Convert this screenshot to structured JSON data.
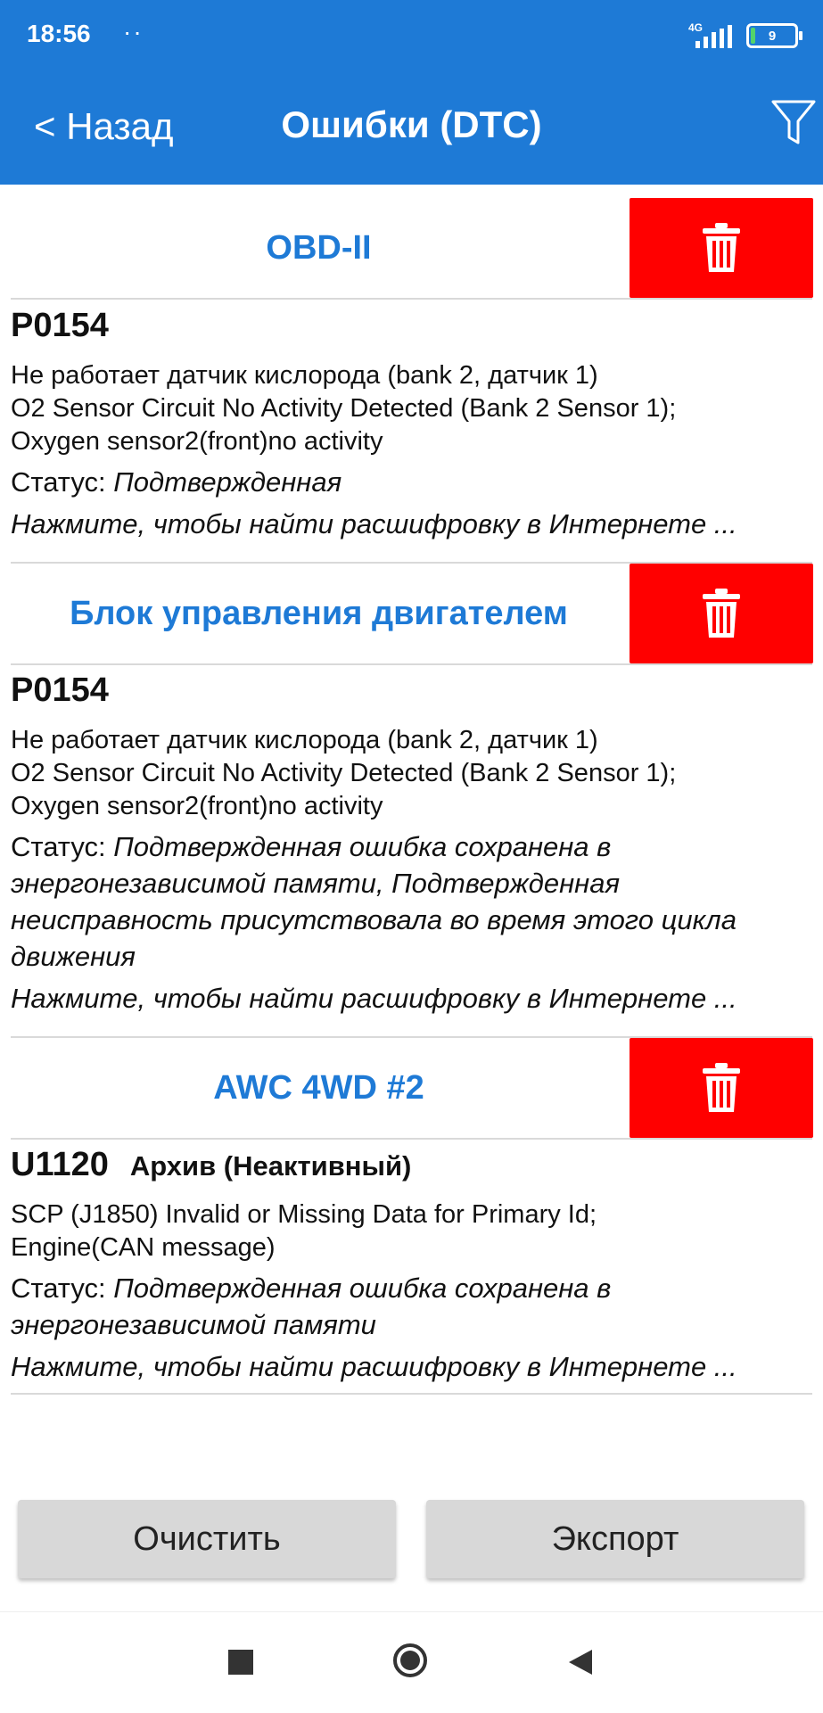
{
  "status_bar": {
    "time": "18:56",
    "dots": "··",
    "network": "4G",
    "battery": "9"
  },
  "app_bar": {
    "back_label": "< Назад",
    "title": "Ошибки (DTC)",
    "filter_icon": "filter-icon"
  },
  "sections": [
    {
      "title": "OBD-II",
      "dtc": {
        "code": "P0154",
        "description_ru": "Не работает датчик кислорода (bank 2, датчик 1)",
        "description_en": "O2 Sensor Circuit No Activity Detected (Bank 2 Sensor 1);",
        "description_en2": "Oxygen sensor2(front)no activity",
        "status_label": "Статус:",
        "status_value": "Подтвержденная",
        "link": "Нажмите, чтобы найти расшифровку в Интернете ..."
      }
    },
    {
      "title": "Блок управления двигателем",
      "dtc": {
        "code": "P0154",
        "description_ru": "Не работает датчик кислорода (bank 2, датчик 1)",
        "description_en": "O2 Sensor Circuit No Activity Detected (Bank 2 Sensor 1);",
        "description_en2": "Oxygen sensor2(front)no activity",
        "status_label": "Статус:",
        "status_value": "Подтвержденная ошибка сохранена в энергонезависимой памяти, Подтвержденная неисправность присутствовала во время этого цикла движения",
        "link": "Нажмите, чтобы найти расшифровку в Интернете ..."
      }
    },
    {
      "title": "AWC 4WD #2",
      "dtc": {
        "code": "U1120",
        "archive": "Архив (Неактивный)",
        "description_en": "SCP (J1850) Invalid or Missing Data for Primary Id;",
        "description_en2": "Engine(CAN message)",
        "status_label": "Статус:",
        "status_value": "Подтвержденная ошибка сохранена в энергонезависимой памяти",
        "link": "Нажмите, чтобы найти расшифровку в Интернете ..."
      }
    }
  ],
  "buttons": {
    "clear": "Очистить",
    "export": "Экспорт"
  },
  "colors": {
    "primary": "#1e7ad6",
    "delete": "#ff0000",
    "button_bg": "#d8d8d8"
  }
}
